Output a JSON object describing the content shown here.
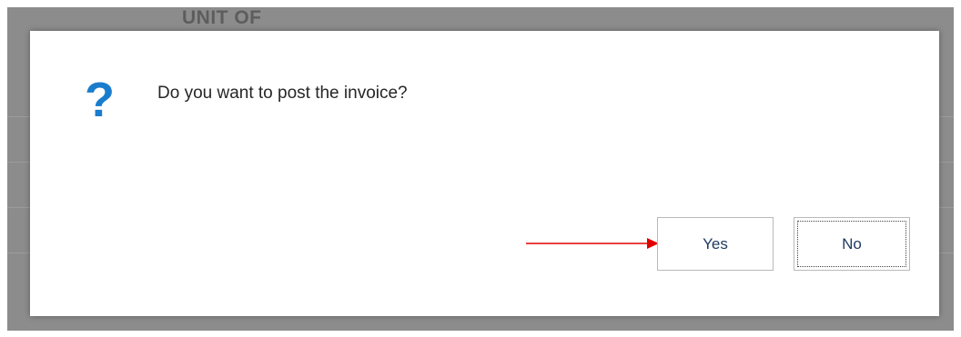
{
  "background": {
    "column_header": "UNIT OF"
  },
  "dialog": {
    "icon": "question-icon",
    "icon_glyph": "?",
    "message": "Do you want to post the invoice?",
    "buttons": {
      "yes_label": "Yes",
      "no_label": "No"
    }
  },
  "annotation": {
    "arrow_icon": "red-arrow-icon",
    "color": "#e00000"
  },
  "colors": {
    "icon_blue": "#1a7ccc",
    "overlay": "#8c8c8c"
  }
}
